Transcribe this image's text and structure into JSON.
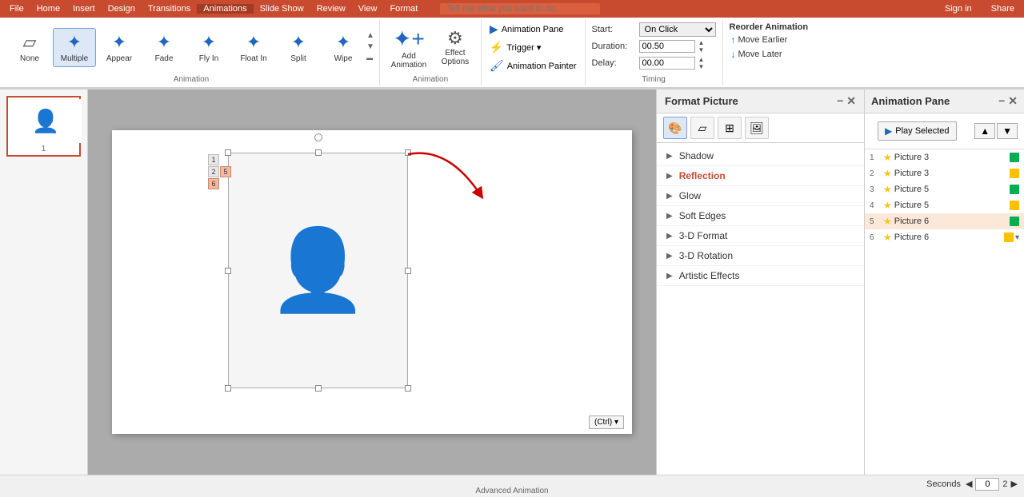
{
  "menubar": {
    "items": [
      "File",
      "Home",
      "Insert",
      "Design",
      "Transitions",
      "Animations",
      "Slide Show",
      "Review",
      "View",
      "Format"
    ],
    "active": "Animations",
    "search_placeholder": "Tell me what you want to do...",
    "sign_in": "Sign in",
    "share": "Share"
  },
  "ribbon": {
    "section_animation": {
      "label": "Animation",
      "buttons": [
        {
          "id": "none",
          "label": "None",
          "icon": "▱"
        },
        {
          "id": "multiple",
          "label": "Multiple",
          "icon": "✦",
          "active": true
        },
        {
          "id": "appear",
          "label": "Appear",
          "icon": "✦"
        },
        {
          "id": "fade",
          "label": "Fade",
          "icon": "✦"
        },
        {
          "id": "fly-in",
          "label": "Fly In",
          "icon": "✦"
        },
        {
          "id": "float-in",
          "label": "Float In",
          "icon": "✦"
        },
        {
          "id": "split",
          "label": "Split",
          "icon": "✦"
        },
        {
          "id": "wipe",
          "label": "Wipe",
          "icon": "✦"
        }
      ]
    },
    "section_add": {
      "label": "Animation",
      "add_label": "Add\nAnimation",
      "effect_label": "Effect\nOptions"
    },
    "section_advanced": {
      "label": "Advanced Animation",
      "animation_pane": "Animation Pane",
      "trigger": "Trigger ▾",
      "animation_painter": "Animation Painter"
    },
    "section_timing": {
      "label": "Timing",
      "start_label": "Start:",
      "start_value": "On Click",
      "duration_label": "Duration:",
      "duration_value": "00.50",
      "delay_label": "Delay:",
      "delay_value": "00.00"
    },
    "section_reorder": {
      "title": "Reorder Animation",
      "move_earlier": "Move Earlier",
      "move_later": "Move Later"
    }
  },
  "format_panel": {
    "title": "Format Picture",
    "tabs": [
      "🎨",
      "▱",
      "⊞",
      "🖼"
    ],
    "options": [
      {
        "label": "Shadow",
        "bold": false
      },
      {
        "label": "Reflection",
        "bold": true
      },
      {
        "label": "Glow",
        "bold": false
      },
      {
        "label": "Soft Edges",
        "bold": false
      },
      {
        "label": "3-D Format",
        "bold": false
      },
      {
        "label": "3-D Rotation",
        "bold": false
      },
      {
        "label": "Artistic Effects",
        "bold": false
      }
    ]
  },
  "animation_pane": {
    "title": "Animation Pane",
    "play_selected": "Play Selected",
    "items": [
      {
        "num": "1",
        "name": "Picture 3",
        "color": "green",
        "selected": false
      },
      {
        "num": "2",
        "name": "Picture 3",
        "color": "yellow",
        "selected": false
      },
      {
        "num": "3",
        "name": "Picture 5",
        "color": "green",
        "selected": false
      },
      {
        "num": "4",
        "name": "Picture 5",
        "color": "yellow",
        "selected": false
      },
      {
        "num": "5",
        "name": "Picture 6",
        "color": "green",
        "selected": true
      },
      {
        "num": "6",
        "name": "Picture 6",
        "color": "yellow",
        "selected": false,
        "has_dropdown": true
      }
    ]
  },
  "status_bar": {
    "seconds_label": "Seconds",
    "page_left": "◀",
    "value_0": "0",
    "value_2": "2",
    "page_right": "▶"
  },
  "slide_labels": {
    "row1": "1",
    "row2_col1": "2",
    "row2_col2": "5",
    "row3": "6"
  },
  "ctrl_badge": "(Ctrl) ▾"
}
